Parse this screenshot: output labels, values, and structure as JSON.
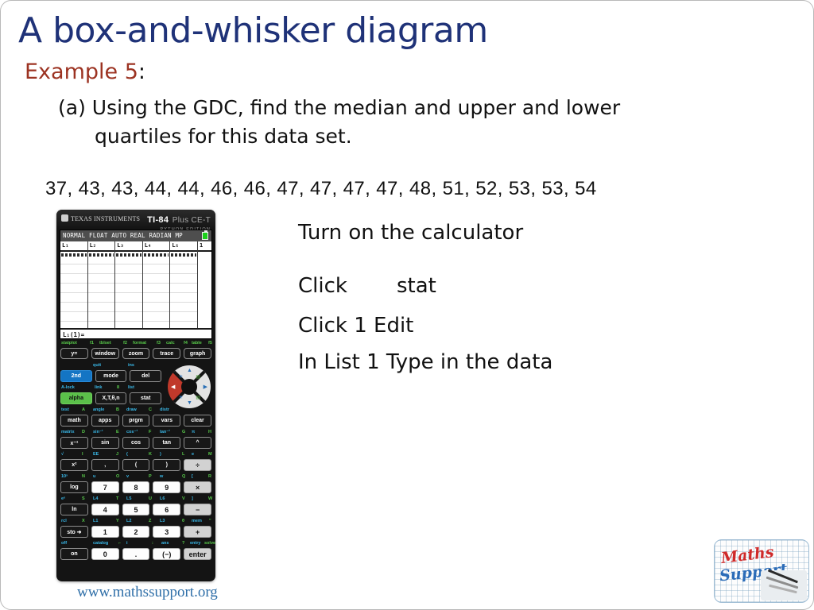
{
  "slide": {
    "title": "A box-and-whisker diagram",
    "example_label": "Example 5",
    "example_colon": ":",
    "question_line_1": "(a) Using the GDC, find the median and upper and lower",
    "question_line_2": "quartiles for this data set.",
    "dataset": "37, 43, 43, 44, 44, 46, 46, 47, 47, 47, 47, 48, 51, 52, 53, 53, 54",
    "site_url": "www.mathssupport.org"
  },
  "instructions": [
    "Turn on the calculator",
    {
      "prefix": "Click",
      "key": "stat"
    },
    "Click 1 Edit",
    "In List 1 Type in the data"
  ],
  "calculator": {
    "brand": "TEXAS INSTRUMENTS",
    "model_1": "TI-84",
    "model_2": "Plus CE-T",
    "model_3": "PYTHON EDITION",
    "screen": {
      "status_bar": "NORMAL FLOAT AUTO REAL RADIAN MP",
      "battery": "battery-icon",
      "list_headers": [
        "L₁",
        "L₂",
        "L₃",
        "L₄",
        "L₅",
        "1"
      ],
      "entry_line": "L₁(1)="
    },
    "function_labels": [
      {
        "name": "statplot",
        "fkey": "f1"
      },
      {
        "name": "tblset",
        "fkey": "f2"
      },
      {
        "name": "format",
        "fkey": "f3"
      },
      {
        "name": "calc",
        "fkey": "f4"
      },
      {
        "name": "table",
        "fkey": "f5"
      }
    ],
    "keys": {
      "fn_row": [
        "y=",
        "window",
        "zoom",
        "trace",
        "graph"
      ],
      "row_2nd": [
        "2nd",
        "mode",
        "del"
      ],
      "row_2nd_sub": [
        "quit",
        "ins"
      ],
      "row_alpha": [
        "alpha",
        "X,T,θ,n",
        "stat"
      ],
      "row_alpha_sub": [
        "A-lock",
        "link",
        "8",
        "list"
      ],
      "row_math": [
        "math",
        "apps",
        "prgm",
        "vars",
        "clear"
      ],
      "row_math_sub": [
        "test",
        "A",
        "angle",
        "B",
        "draw",
        "C",
        "distr"
      ],
      "row_trig": [
        "x⁻¹",
        "sin",
        "cos",
        "tan",
        "^"
      ],
      "row_trig_sub": [
        "matrix",
        "D",
        "sin⁻¹",
        "E",
        "cos⁻¹",
        "F",
        "tan⁻¹",
        "G",
        "π",
        "H"
      ],
      "row_sq": [
        "x²",
        ",",
        "(",
        ")",
        "÷"
      ],
      "row_sq_sub": [
        "√",
        "I",
        "EE",
        "J",
        "(",
        "K",
        ")",
        "L",
        "e",
        "M"
      ],
      "row_log": [
        "log",
        "7",
        "8",
        "9",
        "×"
      ],
      "row_log_sub": [
        "10ˣ",
        "N",
        "u",
        "O",
        "v",
        "P",
        "w",
        "Q",
        "[",
        "R"
      ],
      "row_ln": [
        "ln",
        "4",
        "5",
        "6",
        "−"
      ],
      "row_ln_sub": [
        "eˣ",
        "S",
        "L4",
        "T",
        "L5",
        "U",
        "L6",
        "V",
        "]",
        "W"
      ],
      "row_sto": [
        "sto ➜",
        "1",
        "2",
        "3",
        "+"
      ],
      "row_sto_sub": [
        "rcl",
        "X",
        "L1",
        "Y",
        "L2",
        "Z",
        "L3",
        "θ",
        "mem",
        "\""
      ],
      "row_on": [
        "on",
        "0",
        ".",
        "(−)",
        "enter"
      ],
      "row_on_sub": [
        "off",
        "catalog",
        "⌐",
        "i",
        ":",
        "ans",
        "?",
        "entry",
        "solve"
      ]
    }
  },
  "logo": {
    "word_1": "Maths",
    "word_2": "Support"
  },
  "colors": {
    "title": "#1f3278",
    "example": "#9c3322",
    "url": "#2f6fa8",
    "second_key": "#1475c4",
    "alpha_key": "#5bc04a",
    "dpad_left": "#c0392b",
    "logo_maths": "#cf2a2a",
    "logo_support": "#2b6cb8"
  }
}
